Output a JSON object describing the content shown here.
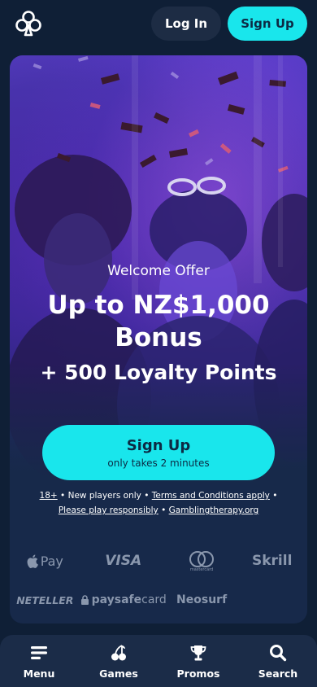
{
  "header": {
    "logo_icon": "clover-logo-icon",
    "login_label": "Log In",
    "signup_label": "Sign Up"
  },
  "hero": {
    "kicker": "Welcome Offer",
    "headline_line1": "Up to NZ$1,000",
    "headline_line2": "Bonus",
    "subline": "+ 500 Loyalty Points"
  },
  "cta": {
    "title": "Sign Up",
    "subtitle": "only takes 2 minutes"
  },
  "terms": {
    "age": "18+",
    "sep1": " • New players only • ",
    "tnc": "Terms and Conditions apply",
    "sep2": " •",
    "responsible": "Please play responsibly",
    "sep3": " • ",
    "gambling_therapy": "Gamblingtherapy.org"
  },
  "payments": {
    "apple_pay": "Pay",
    "visa": "VISA",
    "mastercard_caption": "mastercard",
    "skrill": "Skrill",
    "neteller": "NETELLER",
    "paysafecard_paysafe": "paysafe",
    "paysafecard_card": "card",
    "neosurf": "Neosurf"
  },
  "nav": {
    "items": [
      {
        "label": "Menu",
        "icon": "menu-icon"
      },
      {
        "label": "Games",
        "icon": "cherries-icon"
      },
      {
        "label": "Promos",
        "icon": "trophy-icon"
      },
      {
        "label": "Search",
        "icon": "search-icon"
      }
    ]
  },
  "colors": {
    "background": "#0f1f36",
    "accent": "#19e6ec",
    "card": "#17294a",
    "muted": "#8a97ad"
  }
}
